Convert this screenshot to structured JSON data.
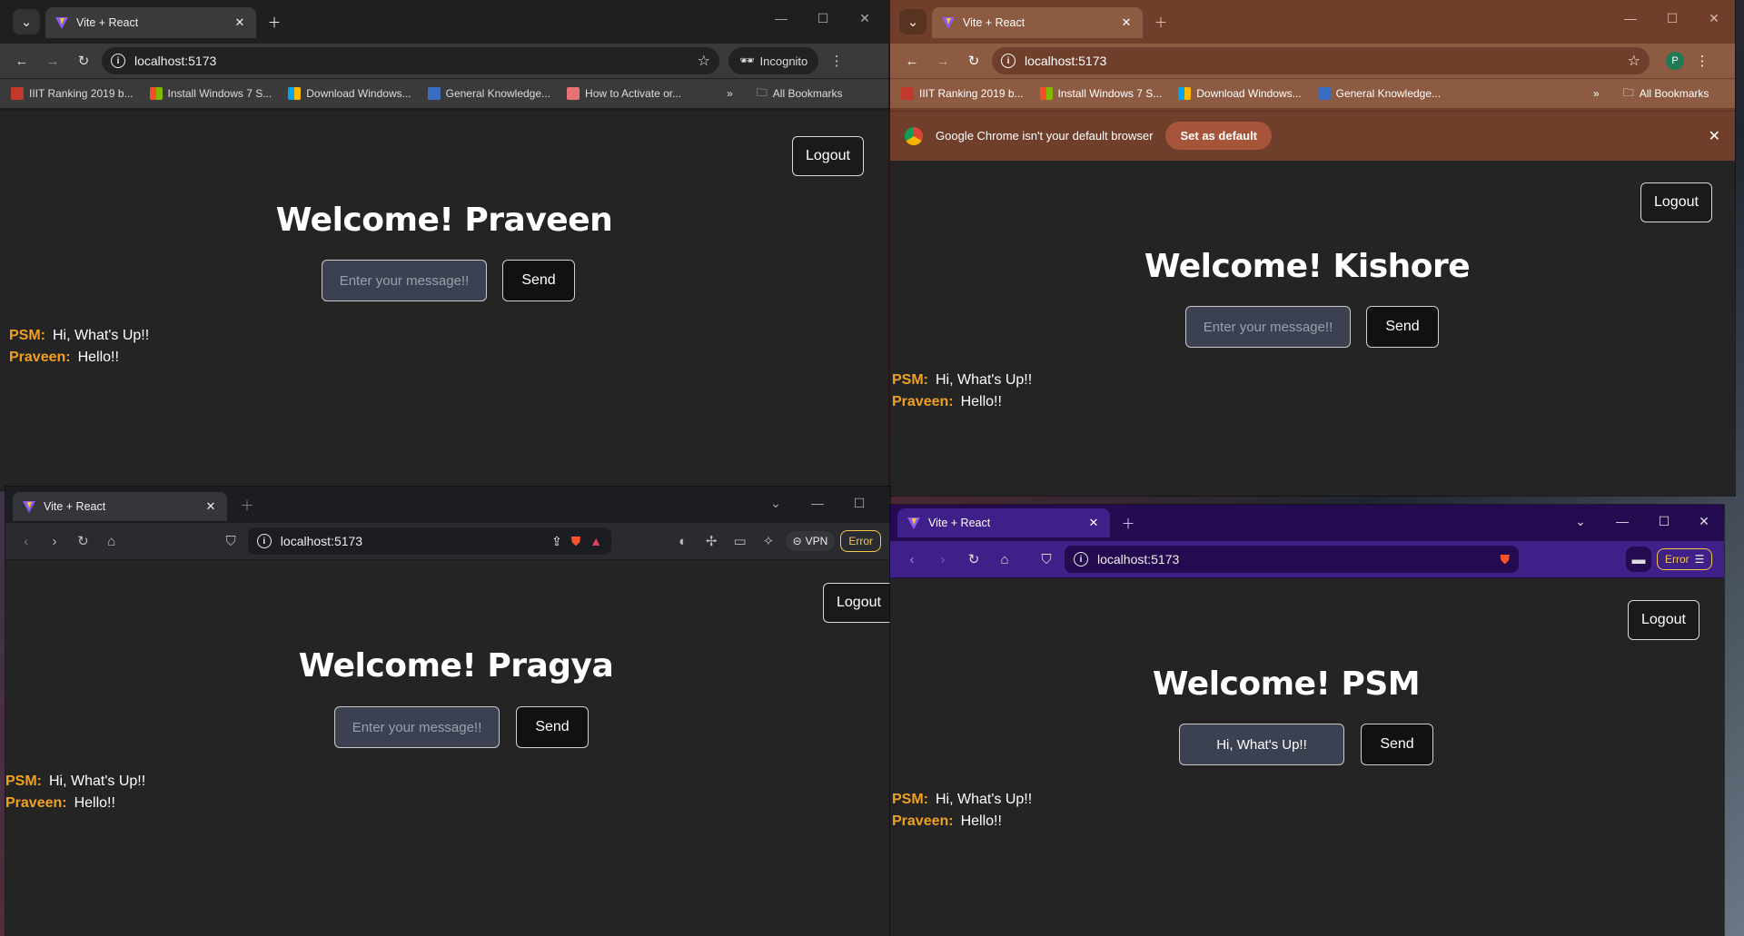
{
  "common": {
    "tab_title": "Vite + React",
    "url": "localhost:5173",
    "logout_label": "Logout",
    "send_label": "Send",
    "input_placeholder": "Enter your message!!",
    "messages": [
      {
        "sender": "PSM:",
        "text": "Hi, What's Up!!"
      },
      {
        "sender": "Praveen:",
        "text": "Hello!!"
      }
    ]
  },
  "w1": {
    "incognito": "Incognito",
    "welcome": "Welcome! Praveen",
    "bookmarks": [
      "IIIT Ranking 2019 b...",
      "Install Windows 7 S...",
      "Download Windows...",
      "General Knowledge...",
      "How to Activate or..."
    ],
    "all_bookmarks": "All Bookmarks"
  },
  "w2": {
    "welcome": "Welcome! Kishore",
    "bookmarks": [
      "IIIT Ranking 2019 b...",
      "Install Windows 7 S...",
      "Download Windows...",
      "General Knowledge..."
    ],
    "all_bookmarks": "All Bookmarks",
    "profile_initial": "P",
    "infobar_text": "Google Chrome isn't your default browser",
    "infobar_button": "Set as default"
  },
  "w3": {
    "welcome": "Welcome! Pragya",
    "vpn": "VPN",
    "error": "Error"
  },
  "w4": {
    "welcome": "Welcome! PSM",
    "input_value": "Hi, What's Up!!",
    "error": "Error"
  },
  "colors": {
    "page_bg": "#242424",
    "sender": "#f0a020",
    "chrome_dark": "#1f1f1f",
    "chrome_brown": "#7a4a34",
    "brave_dark": "#1c1d22",
    "brave_purple": "#2a0f5c"
  }
}
